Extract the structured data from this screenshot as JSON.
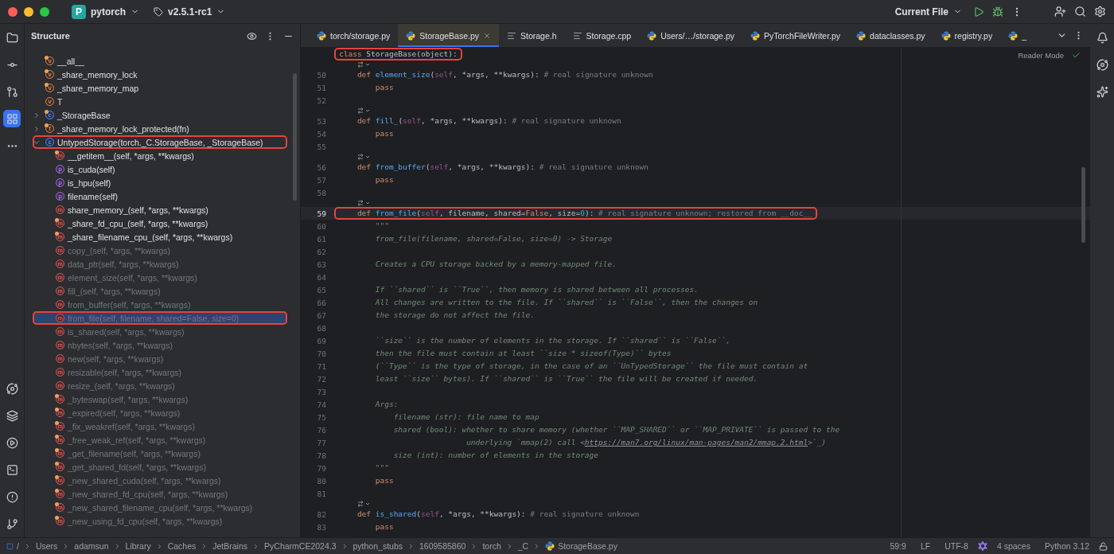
{
  "title_bar": {
    "project_badge": "P",
    "project": "pytorch",
    "branch": "v2.5.1-rc1",
    "run_config": "Current File"
  },
  "structure": {
    "title": "Structure",
    "items": [
      {
        "label": "__all__",
        "kind": "variable",
        "icon": "v",
        "private": true,
        "inherited": false,
        "selected": false,
        "annotated": false
      },
      {
        "label": "_share_memory_lock",
        "kind": "variable",
        "icon": "v",
        "private": true,
        "inherited": false,
        "selected": false,
        "annotated": false
      },
      {
        "label": "_share_memory_map",
        "kind": "variable",
        "icon": "v",
        "private": true,
        "inherited": false,
        "selected": false,
        "annotated": false
      },
      {
        "label": "T",
        "kind": "variable",
        "icon": "v",
        "private": false,
        "inherited": false,
        "selected": false,
        "annotated": false
      },
      {
        "label": "_StorageBase",
        "kind": "class",
        "icon": "c",
        "private": true,
        "inherited": false,
        "selected": false,
        "annotated": false,
        "expanded": false
      },
      {
        "label": "_share_memory_lock_protected(fn)",
        "kind": "function",
        "icon": "f",
        "private": true,
        "inherited": false,
        "selected": false,
        "annotated": false,
        "expanded": false
      },
      {
        "label": "UntypedStorage(torch._C.StorageBase, _StorageBase)",
        "kind": "class",
        "icon": "c",
        "private": false,
        "inherited": false,
        "selected": false,
        "annotated": true,
        "expanded": true,
        "children": [
          {
            "label": "__getitem__(self, *args, **kwargs)",
            "kind": "method",
            "icon": "m",
            "private": true,
            "inherited": false,
            "selected": false,
            "annotated": false
          },
          {
            "label": "is_cuda(self)",
            "kind": "property",
            "icon": "p",
            "private": false,
            "inherited": false,
            "selected": false,
            "annotated": false
          },
          {
            "label": "is_hpu(self)",
            "kind": "property",
            "icon": "p",
            "private": false,
            "inherited": false,
            "selected": false,
            "annotated": false
          },
          {
            "label": "filename(self)",
            "kind": "property",
            "icon": "p",
            "private": false,
            "inherited": false,
            "selected": false,
            "annotated": false
          },
          {
            "label": "share_memory_(self, *args, **kwargs)",
            "kind": "method",
            "icon": "m",
            "private": false,
            "inherited": false,
            "selected": false,
            "annotated": false
          },
          {
            "label": "_share_fd_cpu_(self, *args, **kwargs)",
            "kind": "method",
            "icon": "m",
            "private": true,
            "inherited": false,
            "selected": false,
            "annotated": false
          },
          {
            "label": "_share_filename_cpu_(self, *args, **kwargs)",
            "kind": "method",
            "icon": "m",
            "private": true,
            "inherited": false,
            "selected": false,
            "annotated": false
          },
          {
            "label": "copy_(self, *args, **kwargs)",
            "kind": "method",
            "icon": "m",
            "private": false,
            "inherited": true,
            "selected": false,
            "annotated": false
          },
          {
            "label": "data_ptr(self, *args, **kwargs)",
            "kind": "method",
            "icon": "m",
            "private": false,
            "inherited": true,
            "selected": false,
            "annotated": false
          },
          {
            "label": "element_size(self, *args, **kwargs)",
            "kind": "method",
            "icon": "m",
            "private": false,
            "inherited": true,
            "selected": false,
            "annotated": false
          },
          {
            "label": "fill_(self, *args, **kwargs)",
            "kind": "method",
            "icon": "m",
            "private": false,
            "inherited": true,
            "selected": false,
            "annotated": false
          },
          {
            "label": "from_buffer(self, *args, **kwargs)",
            "kind": "method",
            "icon": "m",
            "private": false,
            "inherited": true,
            "selected": false,
            "annotated": false
          },
          {
            "label": "from_file(self, filename, shared=False, size=0)",
            "kind": "method",
            "icon": "m",
            "private": false,
            "inherited": true,
            "selected": true,
            "annotated": true
          },
          {
            "label": "is_shared(self, *args, **kwargs)",
            "kind": "method",
            "icon": "m",
            "private": false,
            "inherited": true,
            "selected": false,
            "annotated": false
          },
          {
            "label": "nbytes(self, *args, **kwargs)",
            "kind": "method",
            "icon": "m",
            "private": false,
            "inherited": true,
            "selected": false,
            "annotated": false
          },
          {
            "label": "new(self, *args, **kwargs)",
            "kind": "method",
            "icon": "m",
            "private": false,
            "inherited": true,
            "selected": false,
            "annotated": false
          },
          {
            "label": "resizable(self, *args, **kwargs)",
            "kind": "method",
            "icon": "m",
            "private": false,
            "inherited": true,
            "selected": false,
            "annotated": false
          },
          {
            "label": "resize_(self, *args, **kwargs)",
            "kind": "method",
            "icon": "m",
            "private": false,
            "inherited": true,
            "selected": false,
            "annotated": false
          },
          {
            "label": "_byteswap(self, *args, **kwargs)",
            "kind": "method",
            "icon": "m",
            "private": true,
            "inherited": true,
            "selected": false,
            "annotated": false
          },
          {
            "label": "_expired(self, *args, **kwargs)",
            "kind": "method",
            "icon": "m",
            "private": true,
            "inherited": true,
            "selected": false,
            "annotated": false
          },
          {
            "label": "_fix_weakref(self, *args, **kwargs)",
            "kind": "method",
            "icon": "m",
            "private": true,
            "inherited": true,
            "selected": false,
            "annotated": false
          },
          {
            "label": "_free_weak_ref(self, *args, **kwargs)",
            "kind": "method",
            "icon": "m",
            "private": true,
            "inherited": true,
            "selected": false,
            "annotated": false
          },
          {
            "label": "_get_filename(self, *args, **kwargs)",
            "kind": "method",
            "icon": "m",
            "private": true,
            "inherited": true,
            "selected": false,
            "annotated": false
          },
          {
            "label": "_get_shared_fd(self, *args, **kwargs)",
            "kind": "method",
            "icon": "m",
            "private": true,
            "inherited": true,
            "selected": false,
            "annotated": false
          },
          {
            "label": "_new_shared_cuda(self, *args, **kwargs)",
            "kind": "method",
            "icon": "m",
            "private": true,
            "inherited": true,
            "selected": false,
            "annotated": false
          },
          {
            "label": "_new_shared_fd_cpu(self, *args, **kwargs)",
            "kind": "method",
            "icon": "m",
            "private": true,
            "inherited": true,
            "selected": false,
            "annotated": false
          },
          {
            "label": "_new_shared_filename_cpu(self, *args, **kwargs)",
            "kind": "method",
            "icon": "m",
            "private": true,
            "inherited": true,
            "selected": false,
            "annotated": false
          },
          {
            "label": "_new_using_fd_cpu(self, *args, **kwargs)",
            "kind": "method",
            "icon": "m",
            "private": true,
            "inherited": true,
            "selected": false,
            "annotated": false
          }
        ]
      }
    ]
  },
  "tabs": [
    {
      "label": "torch/storage.py",
      "kind": "python",
      "selected": false
    },
    {
      "label": "StorageBase.py",
      "kind": "python",
      "selected": true
    },
    {
      "label": "Storage.h",
      "kind": "text",
      "selected": false
    },
    {
      "label": "Storage.cpp",
      "kind": "text",
      "selected": false
    },
    {
      "label": "Users/…/storage.py",
      "kind": "python",
      "selected": false
    },
    {
      "label": "PyTorchFileWriter.py",
      "kind": "python",
      "selected": false
    },
    {
      "label": "dataclasses.py",
      "kind": "python",
      "selected": false
    },
    {
      "label": "registry.py",
      "kind": "python",
      "selected": false
    },
    {
      "label": "_",
      "kind": "python",
      "selected": false
    }
  ],
  "editor": {
    "reader_mode": "Reader Mode",
    "lines": [
      {
        "kind": "code",
        "current": false,
        "annotated": true,
        "tokens": [
          {
            "kind": "keyword",
            "text": "class "
          },
          {
            "kind": "plain",
            "text": "StorageBase(object):"
          }
        ]
      },
      {
        "kind": "hint"
      },
      {
        "kind": "code",
        "number": "50",
        "current": false,
        "annotated": false,
        "tokens": [
          {
            "kind": "keyword",
            "text": "    def "
          },
          {
            "kind": "function",
            "text": "element_size"
          },
          {
            "kind": "plain",
            "text": "("
          },
          {
            "kind": "self",
            "text": "self"
          },
          {
            "kind": "plain",
            "text": ", *args, **kwargs): "
          },
          {
            "kind": "comment",
            "text": "# real signature unknown"
          }
        ]
      },
      {
        "kind": "code",
        "number": "51",
        "current": false,
        "annotated": false,
        "tokens": [
          {
            "kind": "keyword",
            "text": "        pass"
          }
        ]
      },
      {
        "kind": "code",
        "number": "52",
        "current": false
      },
      {
        "kind": "hint"
      },
      {
        "kind": "code",
        "number": "53",
        "current": false,
        "annotated": false,
        "tokens": [
          {
            "kind": "keyword",
            "text": "    def "
          },
          {
            "kind": "function",
            "text": "fill_"
          },
          {
            "kind": "plain",
            "text": "("
          },
          {
            "kind": "self",
            "text": "self"
          },
          {
            "kind": "plain",
            "text": ", *args, **kwargs): "
          },
          {
            "kind": "comment",
            "text": "# real signature unknown"
          }
        ]
      },
      {
        "kind": "code",
        "number": "54",
        "current": false,
        "annotated": false,
        "tokens": [
          {
            "kind": "keyword",
            "text": "        pass"
          }
        ]
      },
      {
        "kind": "code",
        "number": "55",
        "current": false
      },
      {
        "kind": "hint"
      },
      {
        "kind": "code",
        "number": "56",
        "current": false,
        "annotated": false,
        "tokens": [
          {
            "kind": "keyword",
            "text": "    def "
          },
          {
            "kind": "function",
            "text": "from_buffer"
          },
          {
            "kind": "plain",
            "text": "("
          },
          {
            "kind": "self",
            "text": "self"
          },
          {
            "kind": "plain",
            "text": ", *args, **kwargs): "
          },
          {
            "kind": "comment",
            "text": "# real signature unknown"
          }
        ]
      },
      {
        "kind": "code",
        "number": "57",
        "current": false,
        "annotated": false,
        "tokens": [
          {
            "kind": "keyword",
            "text": "        pass"
          }
        ]
      },
      {
        "kind": "code",
        "number": "58",
        "current": false
      },
      {
        "kind": "hint"
      },
      {
        "kind": "code",
        "number": "59",
        "current": true,
        "annotated": true,
        "tokens": [
          {
            "kind": "keyword",
            "text": "    def "
          },
          {
            "kind": "function",
            "text": "from_file"
          },
          {
            "kind": "plain",
            "text": "("
          },
          {
            "kind": "self",
            "text": "self"
          },
          {
            "kind": "plain",
            "text": ", filename, shared="
          },
          {
            "kind": "keyword",
            "text": "False"
          },
          {
            "kind": "plain",
            "text": ", size="
          },
          {
            "kind": "number",
            "text": "0"
          },
          {
            "kind": "plain",
            "text": "): "
          },
          {
            "kind": "comment",
            "text": "# real signature unknown; restored from __doc__"
          }
        ]
      },
      {
        "kind": "code",
        "number": "60",
        "current": false,
        "annotated": false,
        "tokens": [
          {
            "kind": "doc",
            "text": "        \"\"\""
          }
        ]
      },
      {
        "kind": "code",
        "number": "61",
        "current": false,
        "annotated": false,
        "tokens": [
          {
            "kind": "doc",
            "text": "        from_file(filename, shared=False, size=0) -> Storage"
          }
        ]
      },
      {
        "kind": "code",
        "number": "62",
        "current": false
      },
      {
        "kind": "code",
        "number": "63",
        "current": false,
        "annotated": false,
        "tokens": [
          {
            "kind": "doc",
            "text": "        Creates a CPU storage backed by a memory-mapped file."
          }
        ]
      },
      {
        "kind": "code",
        "number": "64",
        "current": false
      },
      {
        "kind": "code",
        "number": "65",
        "current": false,
        "annotated": false,
        "tokens": [
          {
            "kind": "doc",
            "text": "        If ``shared`` is ``True``, then memory is shared between all processes."
          }
        ]
      },
      {
        "kind": "code",
        "number": "66",
        "current": false,
        "annotated": false,
        "tokens": [
          {
            "kind": "doc",
            "text": "        All changes are written to the file. If ``shared`` is ``False``, then the changes on"
          }
        ]
      },
      {
        "kind": "code",
        "number": "67",
        "current": false,
        "annotated": false,
        "tokens": [
          {
            "kind": "doc",
            "text": "        the storage do not affect the file."
          }
        ]
      },
      {
        "kind": "code",
        "number": "68",
        "current": false
      },
      {
        "kind": "code",
        "number": "69",
        "current": false,
        "annotated": false,
        "tokens": [
          {
            "kind": "doc",
            "text": "        ``size`` is the number of elements in the storage. If ``shared`` is ``False``,"
          }
        ]
      },
      {
        "kind": "code",
        "number": "70",
        "current": false,
        "annotated": false,
        "tokens": [
          {
            "kind": "doc",
            "text": "        then the file must contain at least ``size * sizeof(Type)`` bytes"
          }
        ]
      },
      {
        "kind": "code",
        "number": "71",
        "current": false,
        "annotated": false,
        "tokens": [
          {
            "kind": "doc",
            "text": "        (``Type`` is the type of storage, in the case of an ``UnTypedStorage`` the file must contain at"
          }
        ]
      },
      {
        "kind": "code",
        "number": "72",
        "current": false,
        "annotated": false,
        "tokens": [
          {
            "kind": "doc",
            "text": "        least ``size`` bytes). If ``shared`` is ``True`` the file will be created if needed."
          }
        ]
      },
      {
        "kind": "code",
        "number": "73",
        "current": false
      },
      {
        "kind": "code",
        "number": "74",
        "current": false,
        "annotated": false,
        "tokens": [
          {
            "kind": "doc",
            "text": "        Args:"
          }
        ]
      },
      {
        "kind": "code",
        "number": "75",
        "current": false,
        "annotated": false,
        "tokens": [
          {
            "kind": "doc",
            "text": "            filename (str): file name to map"
          }
        ]
      },
      {
        "kind": "code",
        "number": "76",
        "current": false,
        "annotated": false,
        "tokens": [
          {
            "kind": "doc",
            "text": "            shared (bool): whether to share memory (whether ``MAP_SHARED`` or ``MAP_PRIVATE`` is passed to the"
          }
        ]
      },
      {
        "kind": "code",
        "number": "77",
        "current": false,
        "annotated": false,
        "tokens": [
          {
            "kind": "doc",
            "text": "                            underlying `mmap(2) call <"
          },
          {
            "kind": "link",
            "text": "https://man7.org/linux/man-pages/man2/mmap.2.html"
          },
          {
            "kind": "doc",
            "text": ">`_)"
          }
        ]
      },
      {
        "kind": "code",
        "number": "78",
        "current": false,
        "annotated": false,
        "tokens": [
          {
            "kind": "doc",
            "text": "            size (int): number of elements in the storage"
          }
        ]
      },
      {
        "kind": "code",
        "number": "79",
        "current": false,
        "annotated": false,
        "tokens": [
          {
            "kind": "doc",
            "text": "        \"\"\""
          }
        ]
      },
      {
        "kind": "code",
        "number": "80",
        "current": false,
        "annotated": false,
        "tokens": [
          {
            "kind": "keyword",
            "text": "        pass"
          }
        ]
      },
      {
        "kind": "code",
        "number": "81",
        "current": false
      },
      {
        "kind": "hint"
      },
      {
        "kind": "code",
        "number": "82",
        "current": false,
        "annotated": false,
        "tokens": [
          {
            "kind": "keyword",
            "text": "    def "
          },
          {
            "kind": "function",
            "text": "is_shared"
          },
          {
            "kind": "plain",
            "text": "("
          },
          {
            "kind": "self",
            "text": "self"
          },
          {
            "kind": "plain",
            "text": ", *args, **kwargs): "
          },
          {
            "kind": "comment",
            "text": "# real signature unknown"
          }
        ]
      },
      {
        "kind": "code",
        "number": "83",
        "current": false,
        "annotated": false,
        "tokens": [
          {
            "kind": "keyword",
            "text": "        pass"
          }
        ]
      }
    ]
  },
  "status_bar": {
    "breadcrumbs": [
      {
        "label": "/",
        "kind": "root"
      },
      {
        "label": "Users",
        "kind": "folder"
      },
      {
        "label": "adamsun",
        "kind": "folder"
      },
      {
        "label": "Library",
        "kind": "folder"
      },
      {
        "label": "Caches",
        "kind": "folder"
      },
      {
        "label": "JetBrains",
        "kind": "folder"
      },
      {
        "label": "PyCharmCE2024.3",
        "kind": "folder"
      },
      {
        "label": "python_stubs",
        "kind": "folder"
      },
      {
        "label": "1609585860",
        "kind": "folder"
      },
      {
        "label": "torch",
        "kind": "folder"
      },
      {
        "label": "_C",
        "kind": "folder"
      },
      {
        "label": "StorageBase.py",
        "kind": "python"
      }
    ],
    "position": "59:9",
    "line_separator": "LF",
    "encoding": "UTF-8",
    "indent": "4 spaces",
    "interpreter": "Python 3.12"
  }
}
